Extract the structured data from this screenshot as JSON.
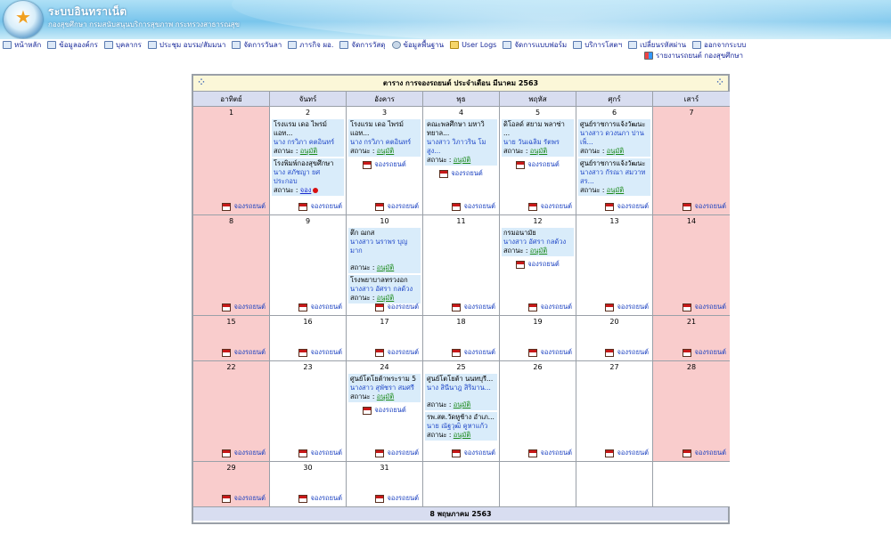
{
  "header": {
    "title": "ระบบอินทราเน็ต",
    "subtitle": "กองสุขศึกษา กรมสนับสนุนบริการสุขภาพ กระทรวงสาธารณสุข"
  },
  "menu": [
    {
      "label": "หน้าหลัก",
      "icon": "monitor-icon"
    },
    {
      "label": "ข้อมูลองค์กร",
      "icon": "document-icon"
    },
    {
      "label": "บุคลากร",
      "icon": "person-icon"
    },
    {
      "label": "ประชุม อบรม/สัมมนา",
      "icon": "table-icon"
    },
    {
      "label": "จัดการวันลา",
      "icon": "calendar-icon"
    },
    {
      "label": "ภารกิจ ผอ.",
      "icon": "grid-icon"
    },
    {
      "label": "จัดการวัสดุ",
      "icon": "box-icon"
    },
    {
      "label": "ข้อมูลพื้นฐาน",
      "icon": "gear-icon"
    },
    {
      "label": "User Logs",
      "icon": "folder-icon"
    },
    {
      "label": "จัดการแบบฟอร์ม",
      "icon": "form-icon"
    },
    {
      "label": "บริการโสตฯ",
      "icon": "media-icon"
    },
    {
      "label": "เปลี่ยนรหัสผ่าน",
      "icon": "key-icon"
    },
    {
      "label": "ออกจากระบบ",
      "icon": "logout-icon"
    }
  ],
  "menu_extra": {
    "label": "รายงานรถยนต์ กองสุขศึกษา",
    "icon": "car-report-icon"
  },
  "calendar": {
    "title": "ตาราง การจองรถยนต์ ประจำเดือน มีนาคม 2563",
    "days_of_week": [
      "อาทิตย์",
      "จันทร์",
      "อังคาร",
      "พุธ",
      "พฤหัส",
      "ศุกร์",
      "เสาร์"
    ],
    "book_label": "จองรถยนต์",
    "status_label": "สถานะ :",
    "footer": "8 พฤษภาคม 2563",
    "weeks": [
      [
        {
          "num": "1",
          "weekend": true,
          "events": []
        },
        {
          "num": "2",
          "events": [
            {
              "place": "โรงแรม เดอ ไพรม์ แอท...",
              "person": "นาง กรวิภา คตอินทร์",
              "status": "อนุมัติ"
            },
            {
              "place": "โรงพิมพ์กองสุขศึกษา",
              "person": "นาง สภัชญา ยศประกอบ",
              "status": "จอง",
              "pending": true
            }
          ]
        },
        {
          "num": "3",
          "events": [
            {
              "place": "โรงแรม เดอ ไพรม์ แอท...",
              "person": "นาง กรวิภา คตอินทร์",
              "status": "อนุมัติ"
            }
          ]
        },
        {
          "num": "4",
          "events": [
            {
              "place": "คณะพลศึกษา มหาวิทยาล...",
              "person": "นางสาว วิภาวริน โมสูง...",
              "status": "อนุมัติ"
            }
          ]
        },
        {
          "num": "5",
          "events": [
            {
              "place": "ดิโอลด์ สยาม พลาซ่า ...",
              "person": "นาย วันเฉลิม รัตพร",
              "status": "อนุมัติ"
            }
          ]
        },
        {
          "num": "6",
          "events": [
            {
              "place": "ศูนย์ราชการแจ้งวัฒนะ",
              "person": "นางสาว ดวงนภา ปานเพ็...",
              "status": "อนุมัติ"
            },
            {
              "place": "ศูนย์ราชการแจ้งวัฒนะ",
              "person": "นางสาว กัรณา สมวาทสร...",
              "status": "อนุมัติ"
            }
          ]
        },
        {
          "num": "7",
          "weekend": true,
          "events": []
        }
      ],
      [
        {
          "num": "8",
          "weekend": true,
          "events": []
        },
        {
          "num": "9",
          "events": []
        },
        {
          "num": "10",
          "events": [
            {
              "place": "ตึก ฌกส",
              "person": "นางสาว นราพร บุญมาก",
              "status": "อนุมัติ",
              "gap": true
            },
            {
              "place": "โรงพยาบาลทรวงอก",
              "person": "นางสาว อัศรา กลด้วง",
              "status": "อนุมัติ"
            }
          ]
        },
        {
          "num": "11",
          "events": []
        },
        {
          "num": "12",
          "events": [
            {
              "place": "กรมอนามัย",
              "person": "นางสาว อัศรา กลด้วง",
              "status": "อนุมัติ"
            }
          ]
        },
        {
          "num": "13",
          "events": []
        },
        {
          "num": "14",
          "weekend": true,
          "events": []
        }
      ],
      [
        {
          "num": "15",
          "weekend": true,
          "events": []
        },
        {
          "num": "16",
          "events": []
        },
        {
          "num": "17",
          "events": []
        },
        {
          "num": "18",
          "events": []
        },
        {
          "num": "19",
          "events": []
        },
        {
          "num": "20",
          "events": []
        },
        {
          "num": "21",
          "weekend": true,
          "events": []
        }
      ],
      [
        {
          "num": "22",
          "weekend": true,
          "events": []
        },
        {
          "num": "23",
          "events": []
        },
        {
          "num": "24",
          "events": [
            {
              "place": "ศูนย์โตโยต้าพระราม 5",
              "person": "นางสาว สุพัชรา สมศรี",
              "status": "อนุมัติ"
            }
          ]
        },
        {
          "num": "25",
          "events": [
            {
              "place": "ศูนย์โตโยต้า นนทบุรี...",
              "person": "นาง สินีนาฎ สิริมาน...",
              "status": "อนุมัติ",
              "gap": true
            },
            {
              "place": "รพ.สต.วัดหูช้าง อำเภ...",
              "person": "นาย ณัฐวุฒิ คูหาแก้ว",
              "status": "อนุมัติ"
            }
          ]
        },
        {
          "num": "26",
          "events": []
        },
        {
          "num": "27",
          "events": []
        },
        {
          "num": "28",
          "weekend": true,
          "events": []
        }
      ],
      [
        {
          "num": "29",
          "weekend": true,
          "events": []
        },
        {
          "num": "30",
          "events": []
        },
        {
          "num": "31",
          "events": []
        },
        {
          "num": "",
          "blank": true,
          "events": []
        },
        {
          "num": "",
          "blank": true,
          "events": []
        },
        {
          "num": "",
          "blank": true,
          "events": []
        },
        {
          "num": "",
          "blank": true,
          "events": []
        }
      ]
    ]
  }
}
